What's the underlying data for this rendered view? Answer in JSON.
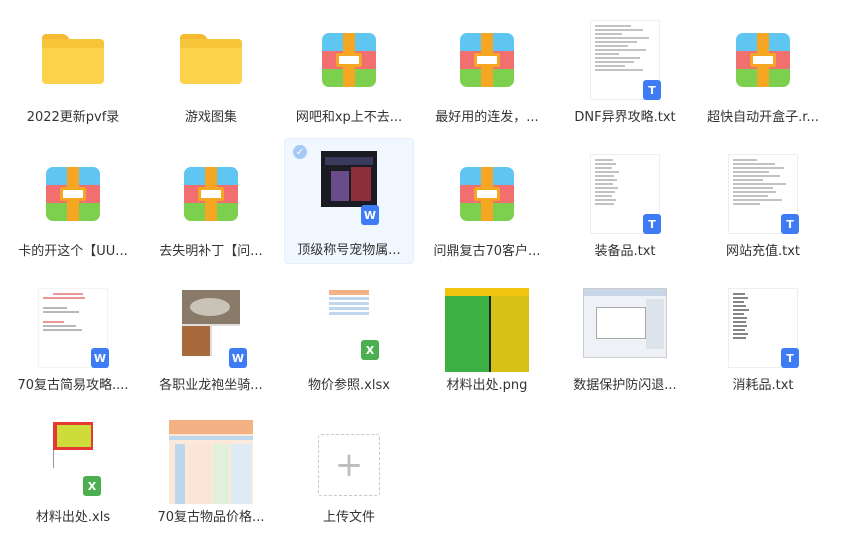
{
  "files": [
    {
      "label": "2022更新pvf录",
      "kind": "folder",
      "badge": ""
    },
    {
      "label": "游戏图集",
      "kind": "folder",
      "badge": ""
    },
    {
      "label": "网吧和xp上不去...",
      "kind": "zip",
      "badge": ""
    },
    {
      "label": "最好用的连发，...",
      "kind": "zip",
      "badge": ""
    },
    {
      "label": "DNF异界攻略.txt",
      "kind": "doc",
      "badge": "T"
    },
    {
      "label": "超快自动开盒子.r...",
      "kind": "zip",
      "badge": ""
    },
    {
      "label": "卡的开这个【UU...",
      "kind": "zip",
      "badge": ""
    },
    {
      "label": "去失明补丁【问...",
      "kind": "zip",
      "badge": ""
    },
    {
      "label": "顶级称号宠物属...",
      "kind": "image-doc",
      "badge": "W"
    },
    {
      "label": "问鼎复古70客户...",
      "kind": "zip",
      "badge": ""
    },
    {
      "label": "装备品.txt",
      "kind": "doc",
      "badge": "T"
    },
    {
      "label": "网站充值.txt",
      "kind": "doc",
      "badge": "T"
    },
    {
      "label": "70复古简易攻略....",
      "kind": "doc",
      "badge": "W"
    },
    {
      "label": "各职业龙袍坐骑...",
      "kind": "image-doc",
      "badge": "W"
    },
    {
      "label": "物价参照.xlsx",
      "kind": "sheet",
      "badge": "X"
    },
    {
      "label": "材料出处.png",
      "kind": "image",
      "badge": ""
    },
    {
      "label": "数据保护防闪退...",
      "kind": "image",
      "badge": ""
    },
    {
      "label": "消耗品.txt",
      "kind": "doc",
      "badge": "T"
    },
    {
      "label": "材料出处.xls",
      "kind": "sheet",
      "badge": "X"
    },
    {
      "label": "70复古物品价格...",
      "kind": "image",
      "badge": ""
    },
    {
      "label": "上传文件",
      "kind": "upload",
      "badge": ""
    }
  ],
  "icons": {
    "upload_plus": "+",
    "selected_check": "✓"
  },
  "colors": {
    "folder": "#fcd24a",
    "zip_blue": "#5fc6f2",
    "zip_red": "#f26f6f",
    "zip_green": "#7dcf4e",
    "zip_strap": "#f5a623",
    "word_badge": "#3d7cf5",
    "excel_badge": "#4caf50",
    "selection_bg": "#f1f7ff"
  },
  "selected_index": 8
}
